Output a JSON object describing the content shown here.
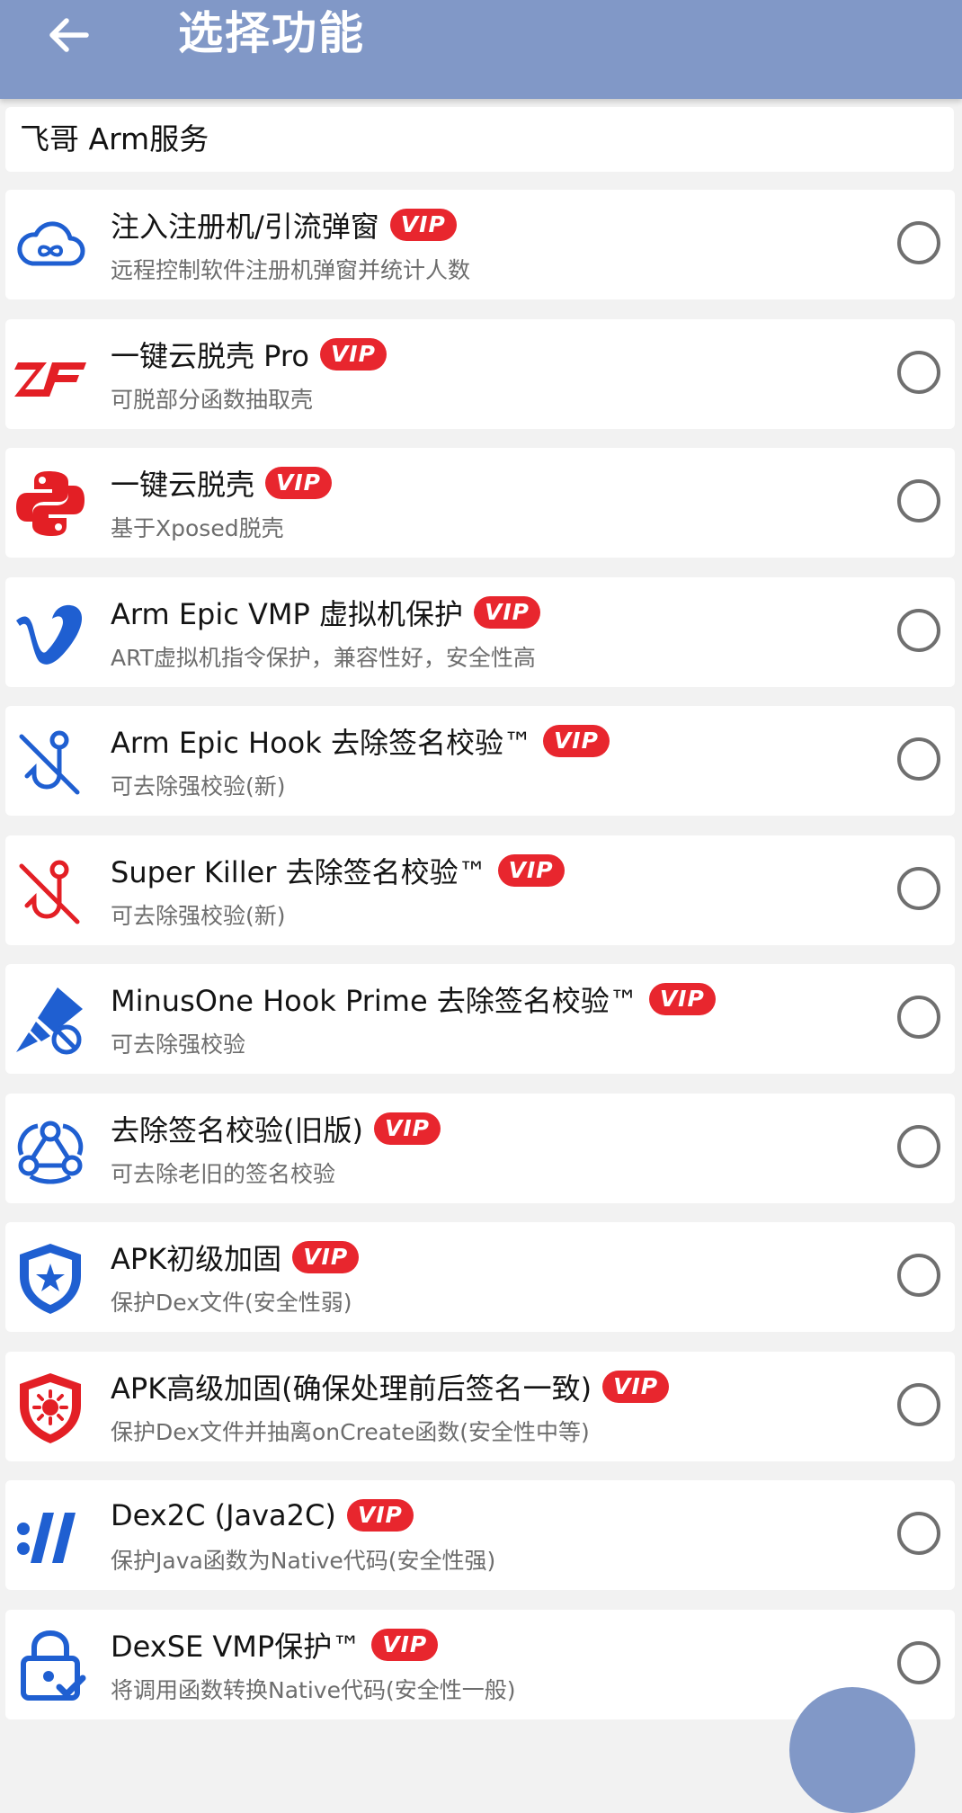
{
  "appbar": {
    "title": "选择功能"
  },
  "section": {
    "label": "飞哥 Arm服务"
  },
  "vip_label": "VIP",
  "items": [
    {
      "title": "注入注册机/引流弹窗",
      "subtitle": "远程控制软件注册机弹窗并统计人数",
      "icon": "cloud-infinity-icon"
    },
    {
      "title": "一键云脱壳 Pro",
      "subtitle": "可脱部分函数抽取壳",
      "icon": "zf-logo-icon"
    },
    {
      "title": "一键云脱壳",
      "subtitle": "基于Xposed脱壳",
      "icon": "python-logo-icon"
    },
    {
      "title": "Arm Epic VMP 虚拟机保护",
      "subtitle": "ART虚拟机指令保护，兼容性好，安全性高",
      "icon": "v-logo-icon"
    },
    {
      "title": "Arm Epic Hook 去除签名校验™",
      "subtitle": "可去除强校验(新)",
      "icon": "hook-off-icon"
    },
    {
      "title": "Super Killer 去除签名校验™",
      "subtitle": "可去除强校验(新)",
      "icon": "hook-off-red-icon"
    },
    {
      "title": "MinusOne Hook Prime 去除签名校验™",
      "subtitle": "可去除强校验",
      "icon": "marker-block-icon"
    },
    {
      "title": "去除签名校验(旧版)",
      "subtitle": "可去除老旧的签名校验",
      "icon": "webhook-icon"
    },
    {
      "title": "APK初级加固",
      "subtitle": "保护Dex文件(安全性弱)",
      "icon": "shield-star-icon"
    },
    {
      "title": "APK高级加固(确保处理前后签名一致)",
      "subtitle": "保护Dex文件并抽离onCreate函数(安全性中等)",
      "icon": "shield-sun-icon"
    },
    {
      "title": "Dex2C (Java2C)",
      "subtitle": "保护Java函数为Native代码(安全性强)",
      "icon": "slashes-logo-icon"
    },
    {
      "title": "DexSE VMP保护™",
      "subtitle": "将调用函数转换Native代码(安全性一般)",
      "icon": "lock-check-icon"
    }
  ],
  "colors": {
    "appbar": "#8198c7",
    "vip_badge": "#e8262e",
    "icon_blue": "#1f5fd1",
    "icon_red": "#e31f25"
  }
}
